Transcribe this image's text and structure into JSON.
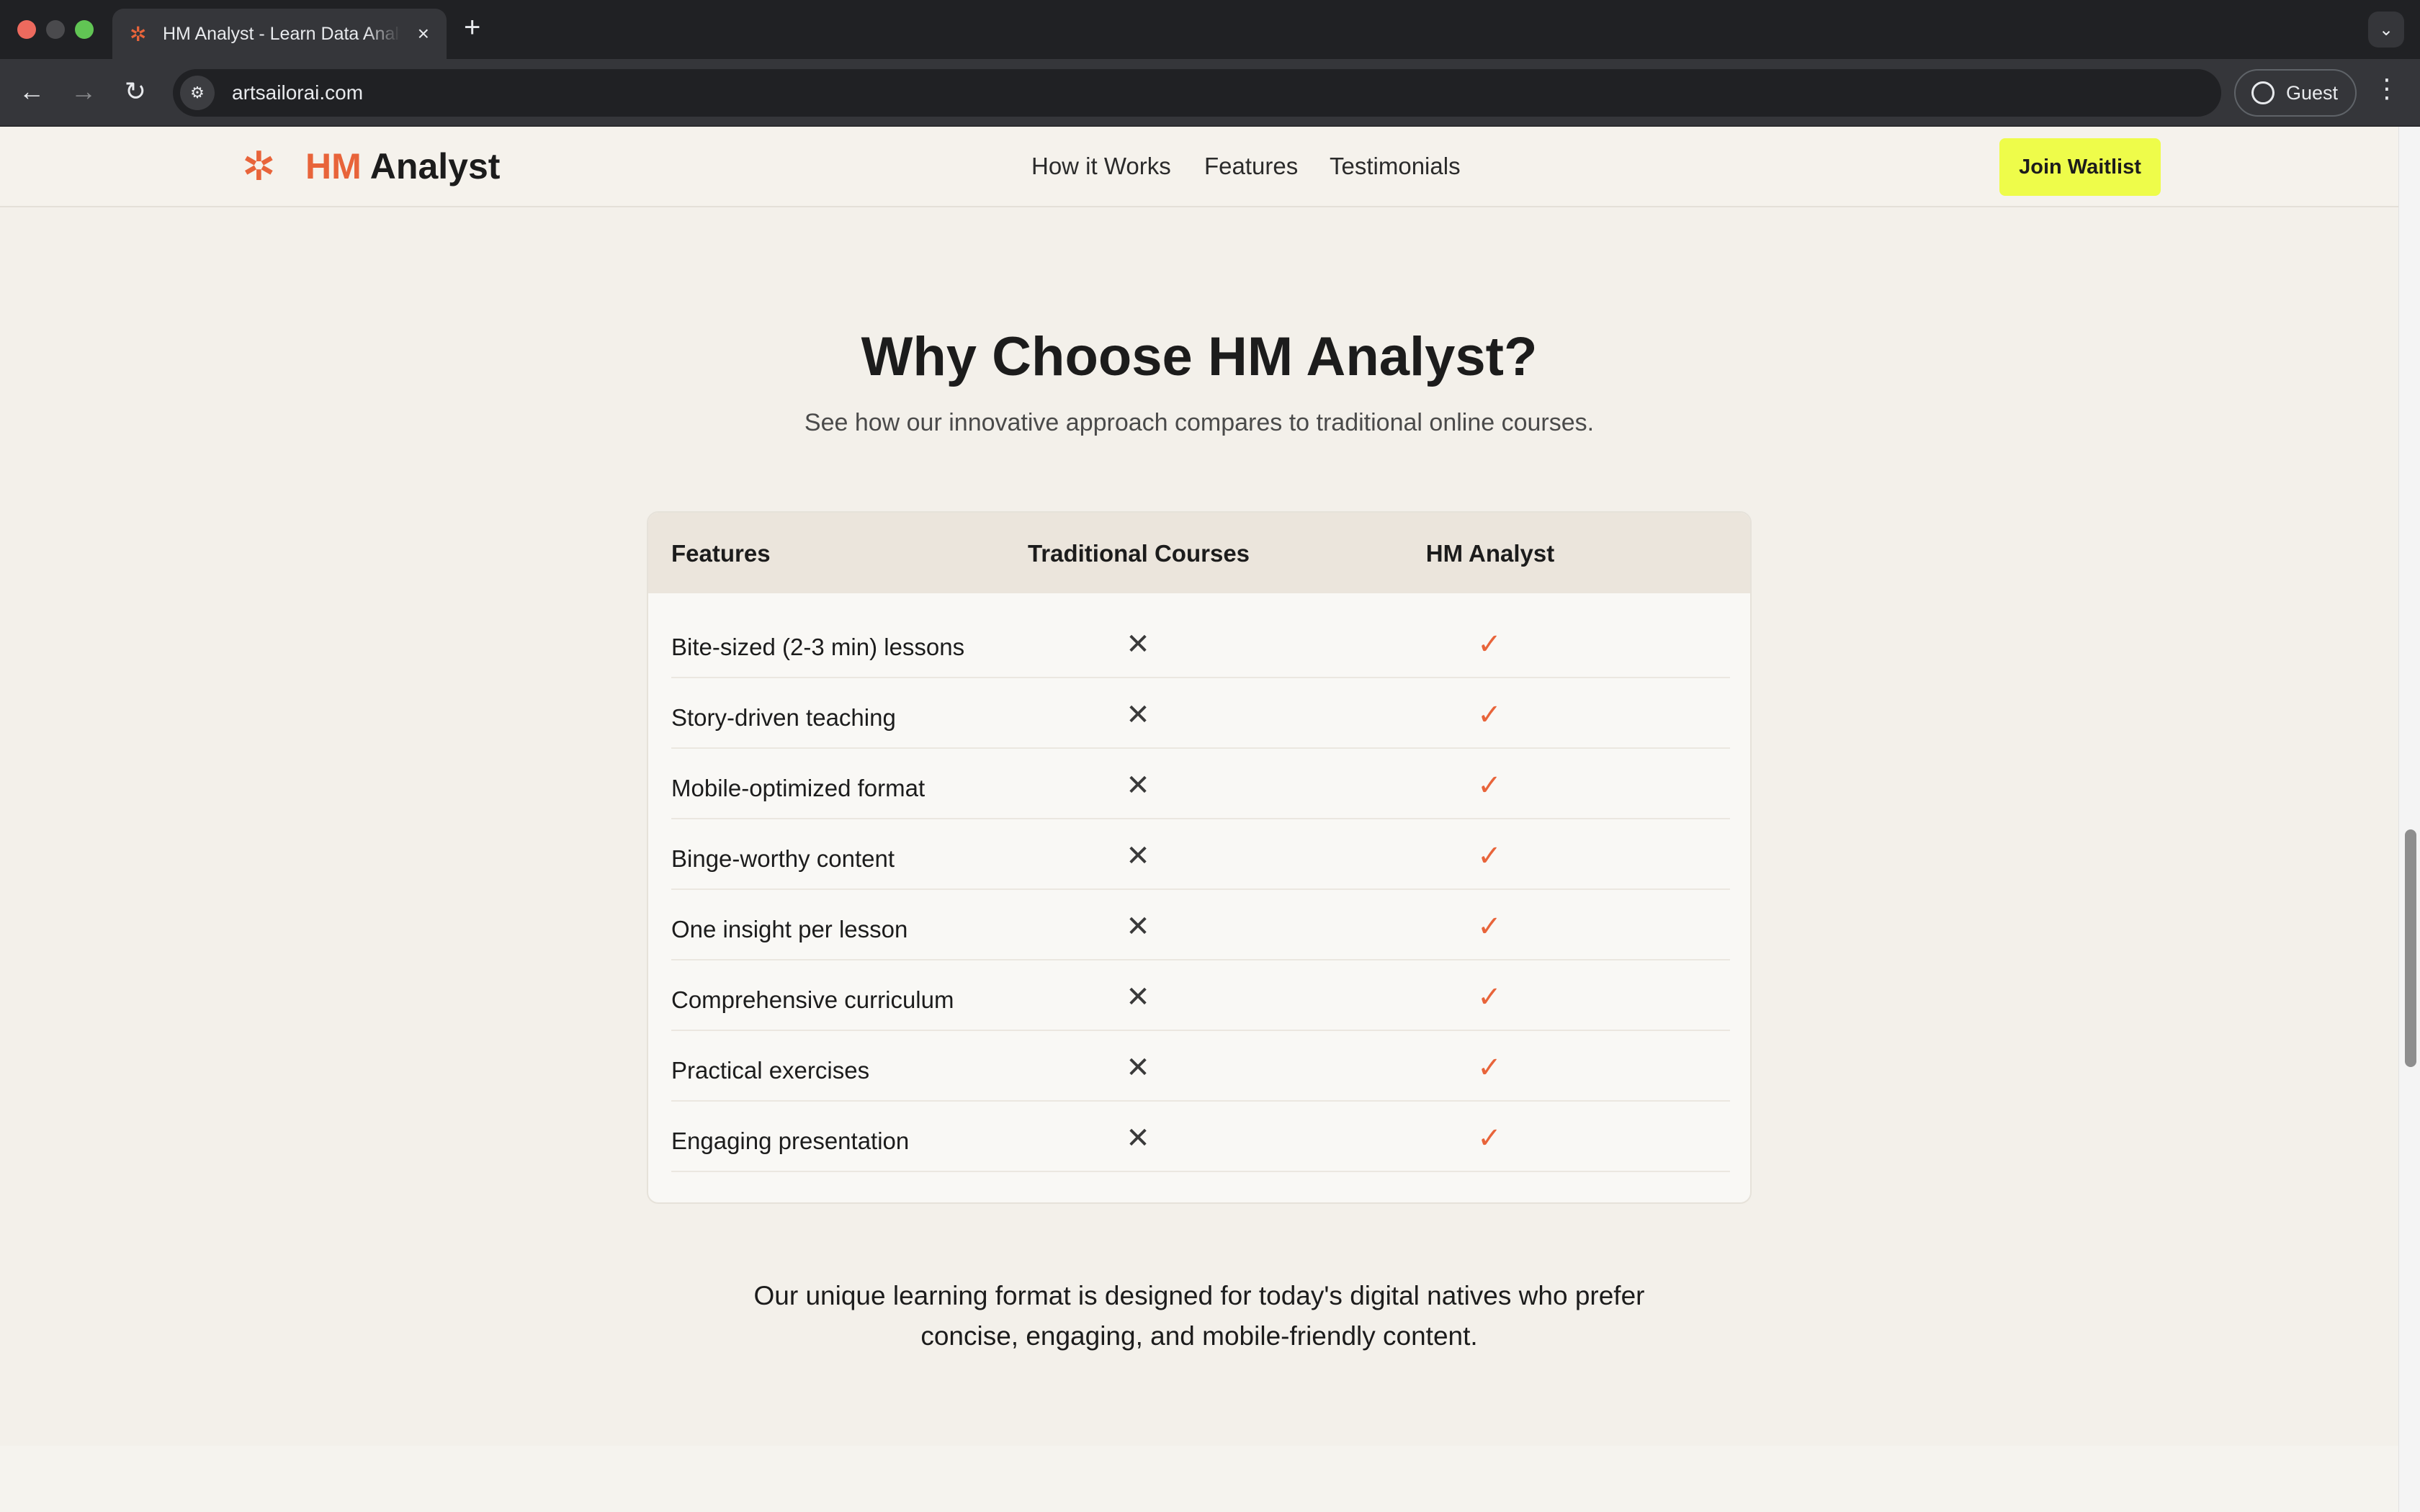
{
  "browser": {
    "tab_title": "HM Analyst - Learn Data Analytics",
    "url": "artsailorai.com",
    "profile_label": "Guest",
    "icons": {
      "favicon": "asterisk",
      "close": "×",
      "new_tab": "+",
      "back": "←",
      "forward": "→",
      "reload": "↻",
      "menu": "⋮",
      "tab_search": "⌄"
    }
  },
  "site": {
    "logo_mark": "✲",
    "logo_hm": "HM",
    "logo_rest": " Analyst",
    "nav": [
      "How it Works",
      "Features",
      "Testimonials"
    ],
    "cta": "Join Waitlist",
    "accent_color": "#e8643a",
    "cta_color": "#eefc4a"
  },
  "section": {
    "title": "Why Choose HM Analyst?",
    "subtitle": "See how our innovative approach compares to traditional online courses.",
    "table": {
      "headers": [
        "Features",
        "Traditional Courses",
        "HM Analyst"
      ],
      "rows": [
        {
          "feature": "Bite-sized (2-3 min) lessons",
          "traditional": "✕",
          "hm": "✓"
        },
        {
          "feature": "Story-driven teaching",
          "traditional": "✕",
          "hm": "✓"
        },
        {
          "feature": "Mobile-optimized format",
          "traditional": "✕",
          "hm": "✓"
        },
        {
          "feature": "Binge-worthy content",
          "traditional": "✕",
          "hm": "✓"
        },
        {
          "feature": "One insight per lesson",
          "traditional": "✕",
          "hm": "✓"
        },
        {
          "feature": "Comprehensive curriculum",
          "traditional": "✕",
          "hm": "✓"
        },
        {
          "feature": "Practical exercises",
          "traditional": "✕",
          "hm": "✓"
        },
        {
          "feature": "Engaging presentation",
          "traditional": "✕",
          "hm": "✓"
        }
      ]
    },
    "closing": "Our unique learning format is designed for today's digital natives who prefer concise, engaging, and mobile-friendly content."
  }
}
